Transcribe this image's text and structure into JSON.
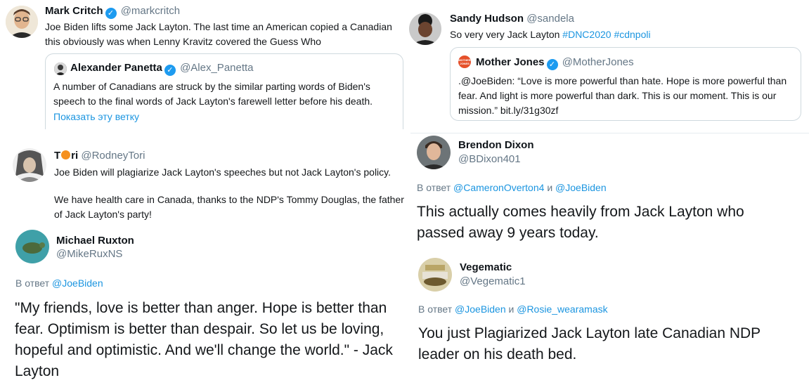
{
  "critch": {
    "name": "Mark Critch",
    "handle": "@markcritch",
    "text": "Joe Biden lifts some Jack Layton. The last time an American copied a Canadian this obviously was when Lenny Kravitz covered the Guess Who",
    "quote": {
      "name": "Alexander Panetta",
      "handle": "@Alex_Panetta",
      "text": "A number of Canadians are struck by the similar parting words of Biden's speech to the final words of Jack Layton's farewell letter before his death.",
      "thread_link": "Показать эту ветку"
    }
  },
  "hudson": {
    "name": "Sandy Hudson",
    "handle": "@sandela",
    "text": "So very very Jack Layton",
    "hashtags": [
      "#DNC2020",
      "#cdnpoli"
    ],
    "quote": {
      "name": "Mother Jones",
      "handle": "@MotherJones",
      "logo_text": "MOTHER JONES",
      "text": ".@JoeBiden: “Love is more powerful than hate. Hope is more powerful than fear. And light is more powerful than dark. This is our moment. This is our mission.”",
      "link": "bit.ly/31g30zf"
    }
  },
  "tori": {
    "name_pre": "T",
    "name_post": "ri",
    "handle": "@RodneyTori",
    "text1": "Joe Biden will plagiarize Jack Layton's speeches but not Jack Layton's policy.",
    "text2": "We have health care in Canada, thanks to the NDP's Tommy Douglas, the father of Jack Layton's party!"
  },
  "dixon": {
    "name": "Brendon Dixon",
    "handle": "@BDixon401",
    "reply_prefix": "В ответ",
    "reply_user1": "@CameronOverton4",
    "reply_and": "и",
    "reply_user2": "@JoeBiden",
    "text": "This actually comes heavily from Jack Layton who passed away 9 years today."
  },
  "ruxton": {
    "name": "Michael Ruxton",
    "handle": "@MikeRuxNS",
    "reply_prefix": "В ответ",
    "reply_user1": "@JoeBiden",
    "text": "\"My friends, love is better than anger. Hope is better than fear. Optimism is better than despair. So let us be loving, hopeful and optimistic. And we'll change the world.\" - Jack Layton"
  },
  "vegematic": {
    "name": "Vegematic",
    "handle": "@Vegematic1",
    "reply_prefix": "В ответ",
    "reply_user1": "@JoeBiden",
    "reply_and": "и",
    "reply_user2": "@Rosie_wearamask",
    "text": "You just Plagiarized Jack Layton late Canadian NDP leader on his death bed."
  },
  "colors": {
    "link": "#1b95e0",
    "verified": "#1d9bf0",
    "muted": "#657786"
  }
}
